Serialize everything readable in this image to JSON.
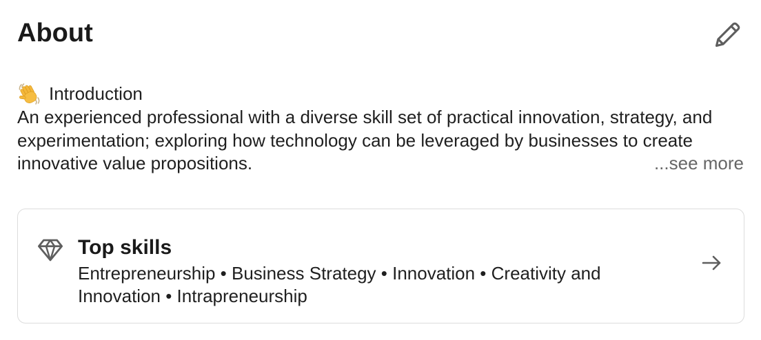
{
  "about": {
    "title": "About",
    "edit_icon": "pencil-icon",
    "intro_emoji": "waving-hand-icon",
    "intro_heading": "Introduction",
    "description": "An experienced professional with a diverse skill set of practical innovation, strategy, and experimentation; exploring how technology can be leveraged by businesses to create innovative value propositions.",
    "see_more": "...see more"
  },
  "top_skills": {
    "icon": "diamond-icon",
    "title": "Top skills",
    "skills": "Entrepreneurship • Business Strategy • Innovation • Creativity and Innovation • Intrapreneurship",
    "arrow_icon": "arrow-right-icon"
  },
  "colors": {
    "text": "#1a1a1a",
    "muted": "#666666",
    "border": "#dcdcdc",
    "icon": "#5e5e5e"
  }
}
